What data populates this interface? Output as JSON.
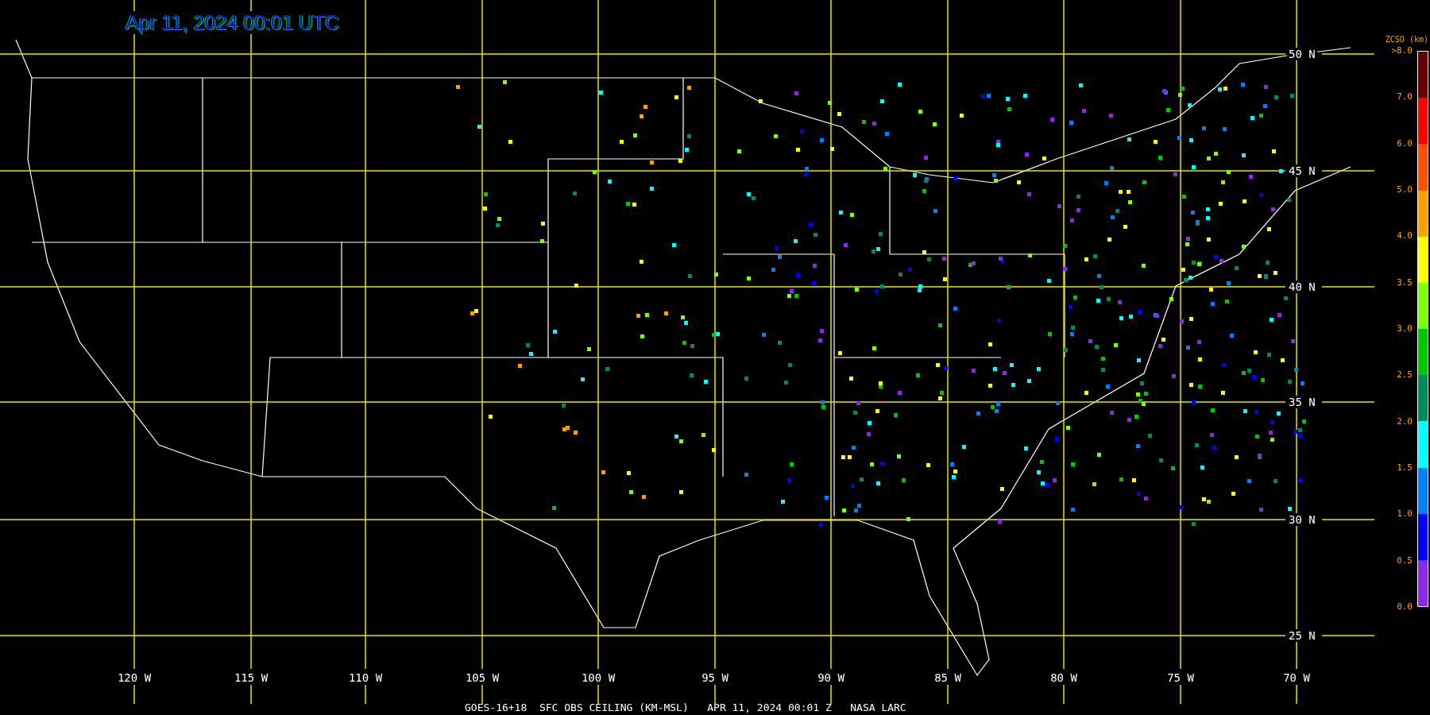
{
  "title": "Apr 11, 2024 00:01 UTC",
  "latitude_labels": [
    "50 N",
    "45 N",
    "40 N",
    "35 N",
    "30 N",
    "25 N"
  ],
  "longitude_labels": [
    "120 W",
    "115 W",
    "110 W",
    "105 W",
    "100 W",
    "95 W",
    "90 W",
    "85 W",
    "80 W",
    "75 W",
    "70 W"
  ],
  "legend": {
    "title": "ZCSO (km)",
    "labels": [
      ">8.0",
      "7.0",
      "6.0",
      "5.0",
      "4.0",
      "3.5",
      "3.0",
      "2.5",
      "2.0",
      "1.5",
      "1.0",
      "0.5",
      "0.0"
    ],
    "segments": [
      {
        "color": "#660000"
      },
      {
        "color": "#ff0000"
      },
      {
        "color": "#ff5000"
      },
      {
        "color": "#ffa000"
      },
      {
        "color": "#ffff00"
      },
      {
        "color": "#80ff00"
      },
      {
        "color": "#00c800"
      },
      {
        "color": "#008c5a"
      },
      {
        "color": "#00ffff"
      },
      {
        "color": "#0080ff"
      },
      {
        "color": "#0000ff"
      },
      {
        "color": "#8c28e6"
      }
    ]
  },
  "footer": "GOES-16+18  SFC OBS CEILING (KM-MSL)   APR 11, 2024 00:01 Z   NASA LARC"
}
